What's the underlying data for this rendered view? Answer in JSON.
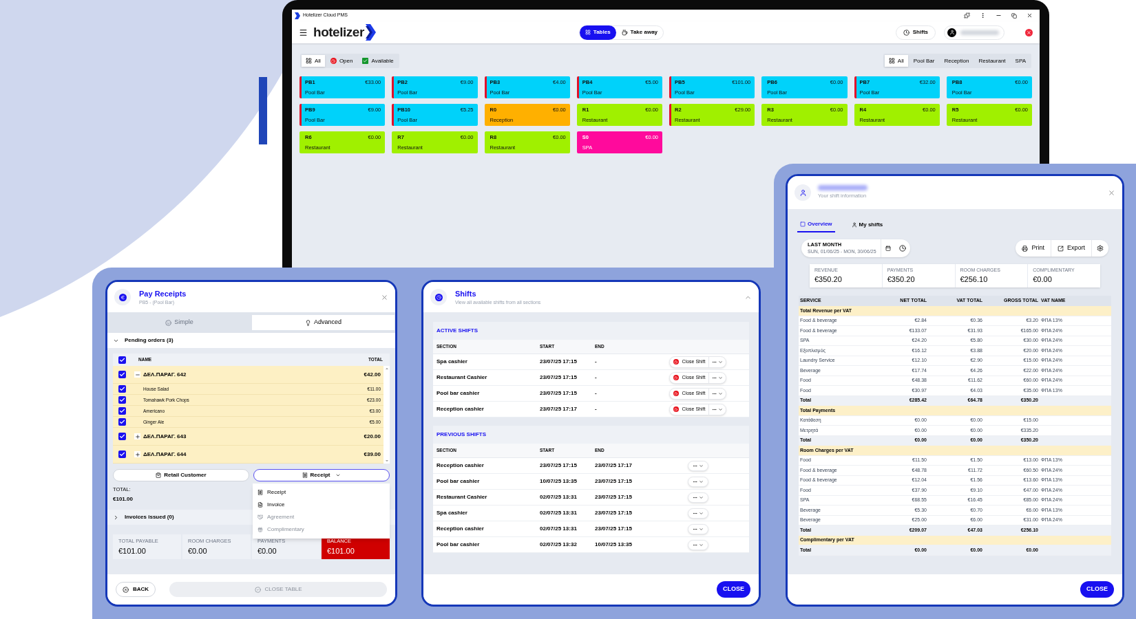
{
  "app": {
    "title": "Hotelizer Cloud PMS",
    "logo": "hotelizer",
    "modes": [
      {
        "label": "Tables",
        "selected": true
      },
      {
        "label": "Take away",
        "selected": false
      }
    ],
    "shifts_button": "Shifts",
    "status_filters": [
      {
        "label": "All",
        "selected": true,
        "kind": "all"
      },
      {
        "label": "Open",
        "selected": false,
        "kind": "open"
      },
      {
        "label": "Available",
        "selected": false,
        "kind": "available"
      }
    ],
    "section_filters": [
      {
        "label": "All",
        "selected": true
      },
      {
        "label": "Pool Bar",
        "selected": false
      },
      {
        "label": "Reception",
        "selected": false
      },
      {
        "label": "Restaurant",
        "selected": false
      },
      {
        "label": "SPA",
        "selected": false
      }
    ],
    "tables": [
      {
        "name": "PB1",
        "amount": "€33.00",
        "section": "Pool Bar",
        "open": true,
        "color": "#00d2fa"
      },
      {
        "name": "PB2",
        "amount": "€9.00",
        "section": "Pool Bar",
        "open": true,
        "color": "#00d2fa"
      },
      {
        "name": "PB3",
        "amount": "€4.00",
        "section": "Pool Bar",
        "open": true,
        "color": "#00d2fa"
      },
      {
        "name": "PB4",
        "amount": "€5.00",
        "section": "Pool Bar",
        "open": true,
        "color": "#00d2fa"
      },
      {
        "name": "PB5",
        "amount": "€101.00",
        "section": "Pool Bar",
        "open": true,
        "color": "#00d2fa"
      },
      {
        "name": "PB6",
        "amount": "€0.00",
        "section": "Pool Bar",
        "open": false,
        "color": "#00d2fa"
      },
      {
        "name": "PB7",
        "amount": "€32.00",
        "section": "Pool Bar",
        "open": true,
        "color": "#00d2fa"
      },
      {
        "name": "PB8",
        "amount": "€0.00",
        "section": "Pool Bar",
        "open": false,
        "color": "#00d2fa"
      },
      {
        "name": "PB9",
        "amount": "€9.00",
        "section": "Pool Bar",
        "open": true,
        "color": "#00d2fa"
      },
      {
        "name": "PB10",
        "amount": "€5.25",
        "section": "Pool Bar",
        "open": true,
        "color": "#00d2fa"
      },
      {
        "name": "R0",
        "amount": "€0.00",
        "section": "Reception",
        "open": false,
        "color": "#ffb000"
      },
      {
        "name": "R1",
        "amount": "€0.00",
        "section": "Restaurant",
        "open": false,
        "color": "#a0f000"
      },
      {
        "name": "R2",
        "amount": "€29.00",
        "section": "Restaurant",
        "open": true,
        "color": "#a0f000"
      },
      {
        "name": "R3",
        "amount": "€0.00",
        "section": "Restaurant",
        "open": false,
        "color": "#a0f000"
      },
      {
        "name": "R4",
        "amount": "€0.00",
        "section": "Restaurant",
        "open": false,
        "color": "#a0f000"
      },
      {
        "name": "R5",
        "amount": "€0.00",
        "section": "Restaurant",
        "open": false,
        "color": "#a0f000"
      },
      {
        "name": "R6",
        "amount": "€0.00",
        "section": "Restaurant",
        "open": false,
        "color": "#a0f000"
      },
      {
        "name": "R7",
        "amount": "€0.00",
        "section": "Restaurant",
        "open": false,
        "color": "#a0f000"
      },
      {
        "name": "R8",
        "amount": "€0.00",
        "section": "Restaurant",
        "open": false,
        "color": "#a0f000"
      },
      {
        "name": "S0",
        "amount": "€0.00",
        "section": "SPA",
        "open": false,
        "color": "#ff0a9c"
      }
    ]
  },
  "pay_receipts": {
    "title": "Pay Receipts",
    "subtitle": "PB5 - (Pool Bar)",
    "modes": [
      {
        "label": "Simple",
        "selected": false
      },
      {
        "label": "Advanced",
        "selected": true
      }
    ],
    "pending": {
      "label": "Pending orders (3)",
      "expanded": true
    },
    "columns": [
      "NAME",
      "TOTAL"
    ],
    "all_checked": true,
    "orders": [
      {
        "name": "ΔΕΛ.ΠΑΡΑΓ. 642",
        "total": "€42.00",
        "checked": true,
        "expanded": true,
        "items": [
          {
            "name": "House Salad",
            "total": "€11.00",
            "checked": true
          },
          {
            "name": "Tomahawk Pork Chops",
            "total": "€23.00",
            "checked": true
          },
          {
            "name": "Americano",
            "total": "€3.00",
            "checked": true
          },
          {
            "name": "Ginger Ale",
            "total": "€5.00",
            "checked": true
          }
        ]
      },
      {
        "name": "ΔΕΛ.ΠΑΡΑΓ. 643",
        "total": "€20.00",
        "checked": true,
        "expanded": false
      },
      {
        "name": "ΔΕΛ.ΠΑΡΑΓ. 644",
        "total": "€39.00",
        "checked": true,
        "expanded": false
      }
    ],
    "customer_button": "Retail Customer",
    "document_button": "Receipt",
    "document_options": [
      {
        "label": "Receipt",
        "kind": "receipt",
        "disabled": false
      },
      {
        "label": "Invoice",
        "kind": "invoice",
        "disabled": false
      },
      {
        "label": "Agreement",
        "kind": "agreement",
        "disabled": true
      },
      {
        "label": "Complimentary",
        "kind": "complimentary",
        "disabled": true
      }
    ],
    "total_label": "TOTAL:",
    "total_value": "€101.00",
    "invoices": {
      "label": "Invoices issued (0)",
      "expanded": false
    },
    "summary": [
      {
        "label": "TOTAL PAYABLE",
        "value": "€101.00",
        "kind": "normal"
      },
      {
        "label": "ROOM CHARGES",
        "value": "€0.00",
        "kind": "normal"
      },
      {
        "label": "PAYMENTS",
        "value": "€0.00",
        "kind": "normal"
      },
      {
        "label": "BALANCE",
        "value": "€101.00",
        "kind": "alert"
      }
    ],
    "back_button": "BACK",
    "close_table_button": {
      "label": "CLOSE TABLE",
      "disabled": true
    }
  },
  "shifts": {
    "title": "Shifts",
    "subtitle": "View all available shifts from all sections",
    "sections": [
      {
        "title": "ACTIVE SHIFTS",
        "columns": [
          "SECTION",
          "START",
          "END"
        ],
        "rows": [
          {
            "section": "Spa cashier",
            "start": "23/07/25 17:15",
            "end": "-",
            "action": "Close Shift"
          },
          {
            "section": "Restaurant Cashier",
            "start": "23/07/25 17:15",
            "end": "-",
            "action": "Close Shift"
          },
          {
            "section": "Pool bar cashier",
            "start": "23/07/25 17:15",
            "end": "-",
            "action": "Close Shift"
          },
          {
            "section": "Reception cashier",
            "start": "23/07/25 17:17",
            "end": "-",
            "action": "Close Shift"
          }
        ]
      },
      {
        "title": "PREVIOUS SHIFTS",
        "columns": [
          "SECTION",
          "START",
          "END"
        ],
        "rows": [
          {
            "section": "Reception cashier",
            "start": "23/07/25 17:15",
            "end": "23/07/25 17:17"
          },
          {
            "section": "Pool bar cashier",
            "start": "10/07/25 13:35",
            "end": "23/07/25 17:15"
          },
          {
            "section": "Restaurant Cashier",
            "start": "02/07/25 13:31",
            "end": "23/07/25 17:15"
          },
          {
            "section": "Spa cashier",
            "start": "02/07/25 13:31",
            "end": "23/07/25 17:15"
          },
          {
            "section": "Reception cashier",
            "start": "02/07/25 13:31",
            "end": "23/07/25 17:15"
          },
          {
            "section": "Pool bar cashier",
            "start": "02/07/25 13:32",
            "end": "10/07/25 13:35"
          }
        ]
      }
    ],
    "close_button": "CLOSE"
  },
  "shift_info": {
    "subtitle": "Your shift information",
    "tabs": [
      {
        "label": "Overview",
        "selected": true
      },
      {
        "label": "My shifts",
        "selected": false
      }
    ],
    "period": {
      "label": "LAST MONTH",
      "range": "SUN, 01/06/25 - MON, 30/06/25"
    },
    "print_button": "Print",
    "export_button": "Export",
    "stats": [
      {
        "label": "REVENUE",
        "value": "€350.20"
      },
      {
        "label": "PAYMENTS",
        "value": "€350.20"
      },
      {
        "label": "ROOM CHARGES",
        "value": "€256.10"
      },
      {
        "label": "COMPLIMENTARY",
        "value": "€0.00"
      }
    ],
    "columns": [
      "SERVICE",
      "NET TOTAL",
      "VAT TOTAL",
      "GROSS TOTAL",
      "VAT NAME"
    ],
    "rows": [
      {
        "kind": "group",
        "service": "Total Revenue per VAT"
      },
      {
        "kind": "item",
        "service": "Food & beverage",
        "net": "€2.84",
        "vat": "€0.36",
        "gross": "€3.20",
        "vat_name": "ΦΠΑ 13%"
      },
      {
        "kind": "item",
        "service": "Food & beverage",
        "net": "€133.07",
        "vat": "€31.93",
        "gross": "€165.00",
        "vat_name": "ΦΠΑ 24%"
      },
      {
        "kind": "item",
        "service": "SPA",
        "net": "€24.20",
        "vat": "€5.80",
        "gross": "€30.00",
        "vat_name": "ΦΠΑ 24%"
      },
      {
        "kind": "item",
        "service": "Εξοπλισμός",
        "net": "€16.12",
        "vat": "€3.88",
        "gross": "€20.00",
        "vat_name": "ΦΠΑ 24%"
      },
      {
        "kind": "item",
        "service": "Laundry Service",
        "net": "€12.10",
        "vat": "€2.90",
        "gross": "€15.00",
        "vat_name": "ΦΠΑ 24%"
      },
      {
        "kind": "item",
        "service": "Beverage",
        "net": "€17.74",
        "vat": "€4.26",
        "gross": "€22.00",
        "vat_name": "ΦΠΑ 24%"
      },
      {
        "kind": "item",
        "service": "Food",
        "net": "€48.38",
        "vat": "€11.62",
        "gross": "€60.00",
        "vat_name": "ΦΠΑ 24%"
      },
      {
        "kind": "item",
        "service": "Food",
        "net": "€30.97",
        "vat": "€4.03",
        "gross": "€35.00",
        "vat_name": "ΦΠΑ 13%"
      },
      {
        "kind": "total",
        "service": "Total",
        "net": "€285.42",
        "vat": "€64.78",
        "gross": "€350.20"
      },
      {
        "kind": "group",
        "service": "Total Payments"
      },
      {
        "kind": "item",
        "service": "Κατάθεση",
        "net": "€0.00",
        "vat": "€0.00",
        "gross": "€15.00"
      },
      {
        "kind": "item",
        "service": "Μετρητά",
        "net": "€0.00",
        "vat": "€0.00",
        "gross": "€335.20"
      },
      {
        "kind": "total",
        "service": "Total",
        "net": "€0.00",
        "vat": "€0.00",
        "gross": "€350.20"
      },
      {
        "kind": "group",
        "service": "Room Charges per VAT"
      },
      {
        "kind": "item",
        "service": "Food",
        "net": "€11.50",
        "vat": "€1.50",
        "gross": "€13.00",
        "vat_name": "ΦΠΑ 13%"
      },
      {
        "kind": "item",
        "service": "Food & beverage",
        "net": "€48.78",
        "vat": "€11.72",
        "gross": "€60.50",
        "vat_name": "ΦΠΑ 24%"
      },
      {
        "kind": "item",
        "service": "Food & beverage",
        "net": "€12.04",
        "vat": "€1.56",
        "gross": "€13.60",
        "vat_name": "ΦΠΑ 13%"
      },
      {
        "kind": "item",
        "service": "Food",
        "net": "€37.90",
        "vat": "€9.10",
        "gross": "€47.00",
        "vat_name": "ΦΠΑ 24%"
      },
      {
        "kind": "item",
        "service": "SPA",
        "net": "€68.55",
        "vat": "€16.45",
        "gross": "€85.00",
        "vat_name": "ΦΠΑ 24%"
      },
      {
        "kind": "item",
        "service": "Beverage",
        "net": "€5.30",
        "vat": "€0.70",
        "gross": "€6.00",
        "vat_name": "ΦΠΑ 13%"
      },
      {
        "kind": "item",
        "service": "Beverage",
        "net": "€25.00",
        "vat": "€6.00",
        "gross": "€31.00",
        "vat_name": "ΦΠΑ 24%"
      },
      {
        "kind": "total",
        "service": "Total",
        "net": "€209.07",
        "vat": "€47.03",
        "gross": "€256.10"
      },
      {
        "kind": "group",
        "service": "Complimentary per VAT"
      },
      {
        "kind": "total",
        "service": "Total",
        "net": "€0.00",
        "vat": "€0.00",
        "gross": "€0.00"
      }
    ],
    "close_button": "CLOSE"
  }
}
